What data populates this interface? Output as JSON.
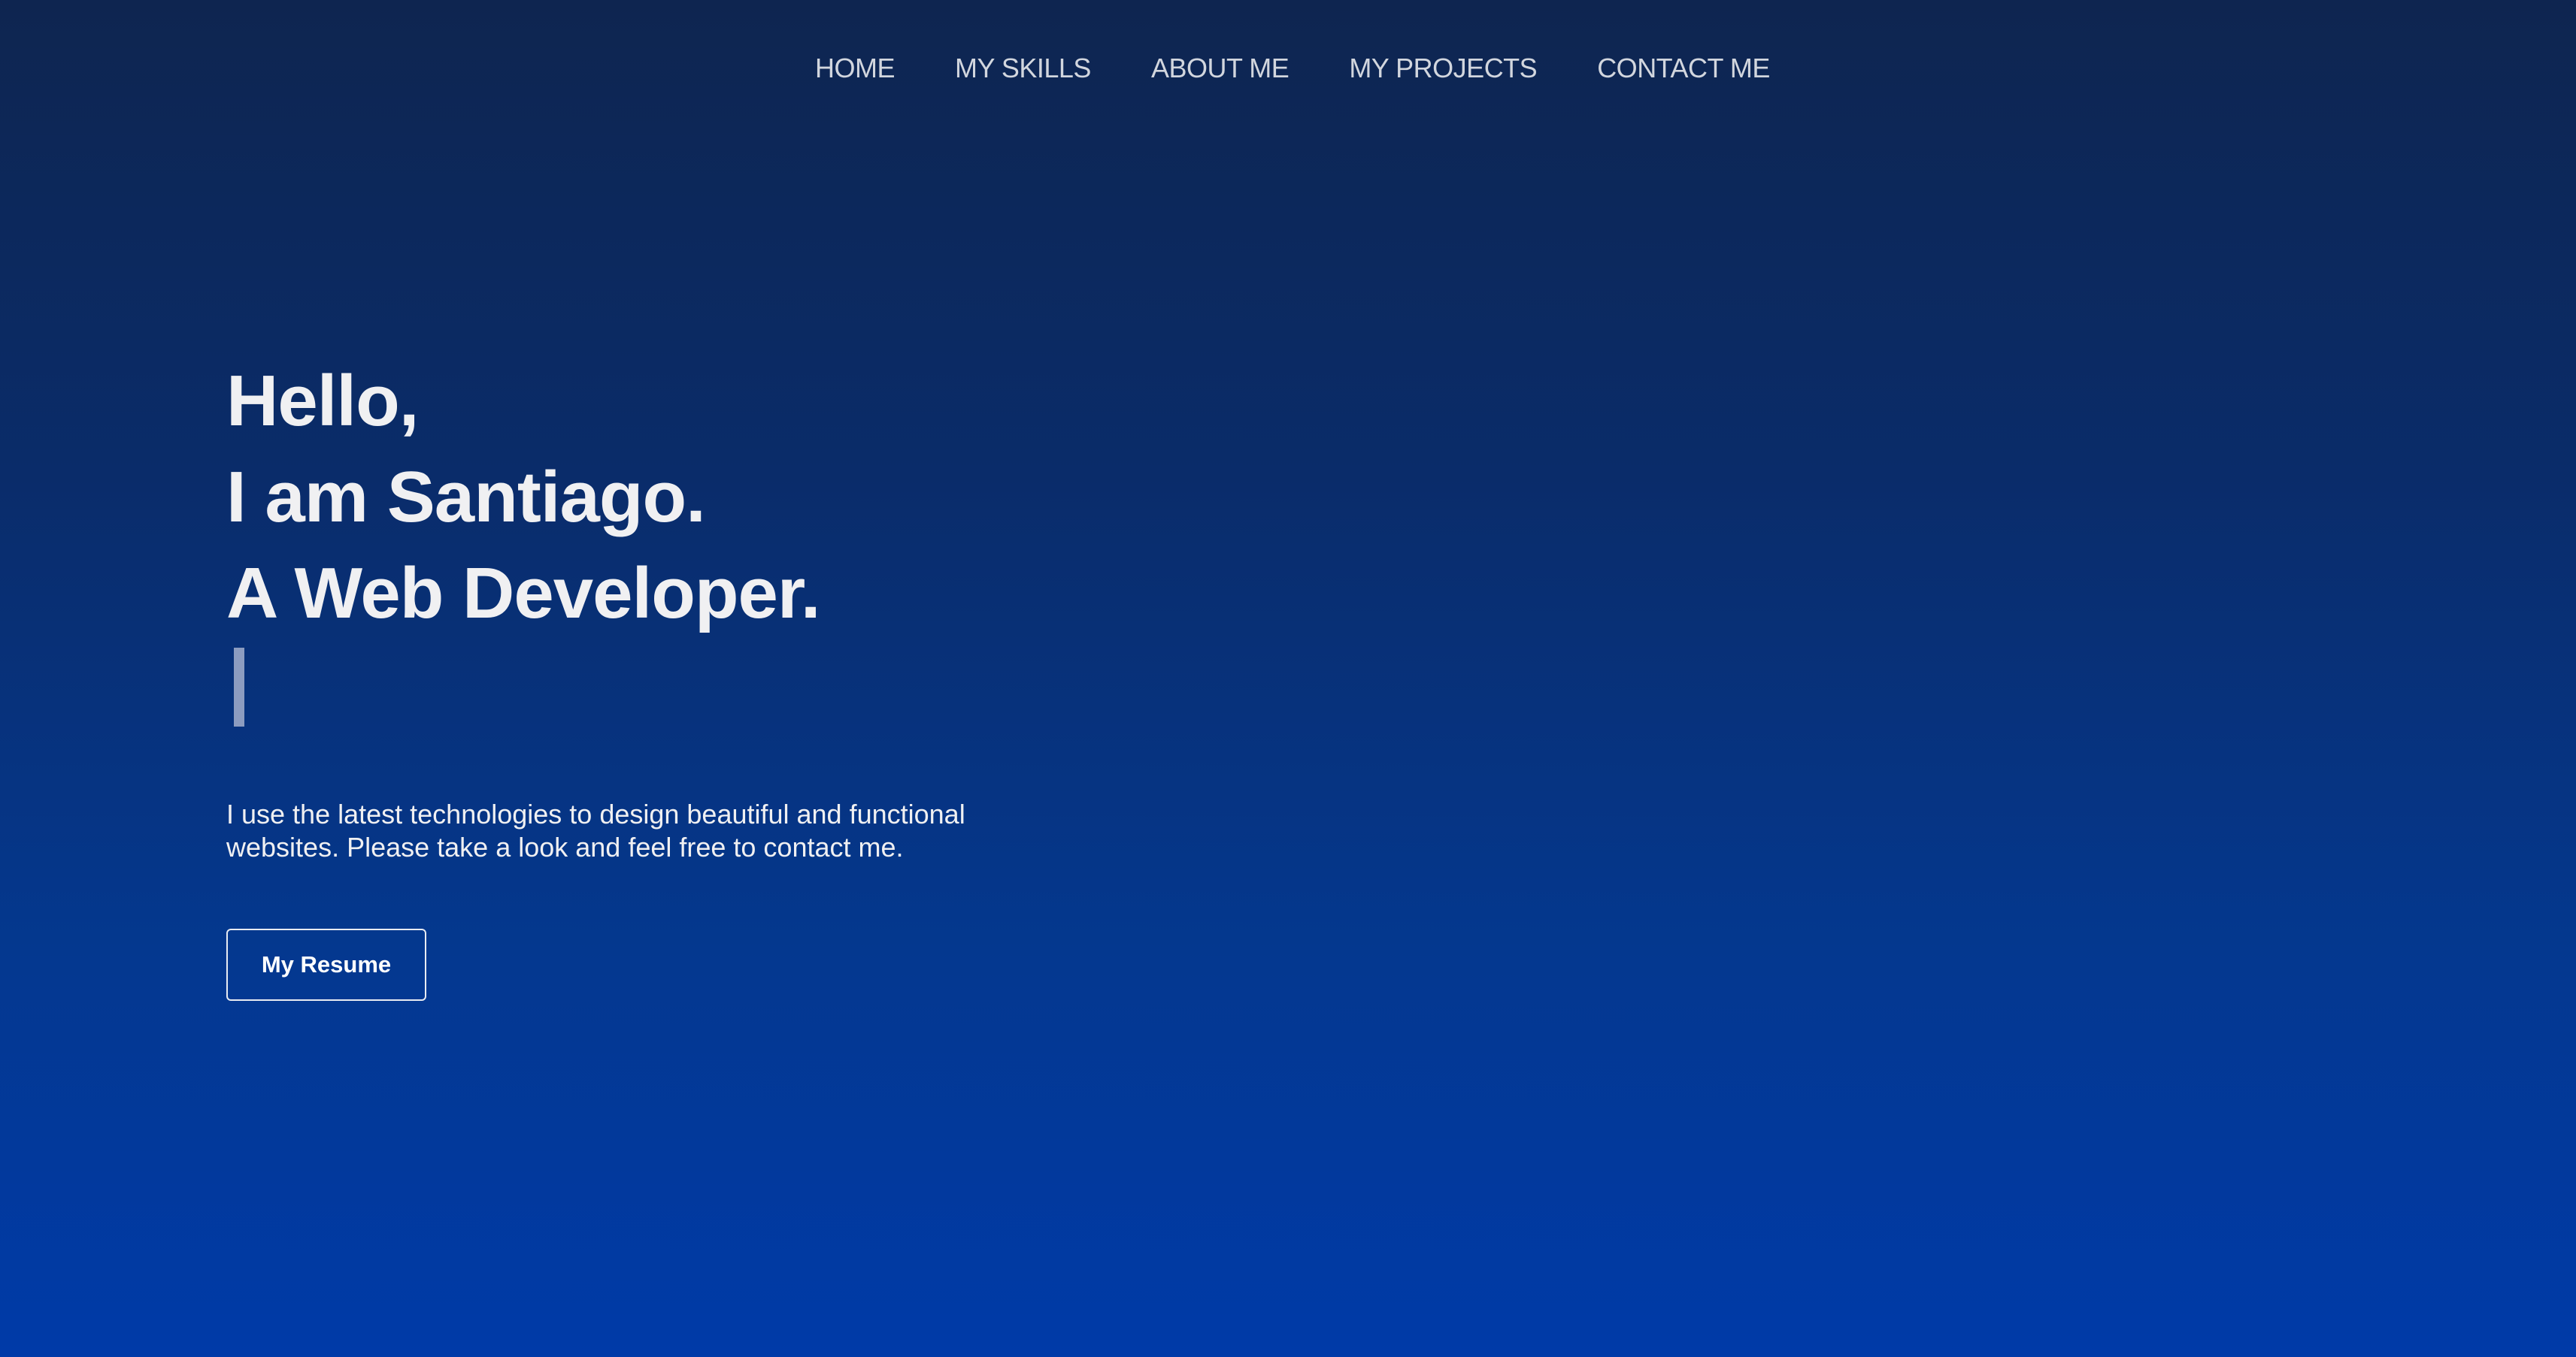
{
  "nav": {
    "items": [
      {
        "label": "HOME"
      },
      {
        "label": "MY SKILLS"
      },
      {
        "label": "ABOUT ME"
      },
      {
        "label": "MY PROJECTS"
      },
      {
        "label": "CONTACT ME"
      }
    ]
  },
  "hero": {
    "line1": "Hello,",
    "line2": "I am Santiago.",
    "line3": "A Web Developer.",
    "description": "I use the latest technologies to design beautiful and functional websites. Please take a look and feel free to contact me.",
    "resume_label": "My Resume"
  },
  "colors": {
    "bg_top": "#0e2550",
    "bg_bottom": "#003aa8",
    "text": "#f0f0f2",
    "nav_text": "#d2d6de"
  }
}
